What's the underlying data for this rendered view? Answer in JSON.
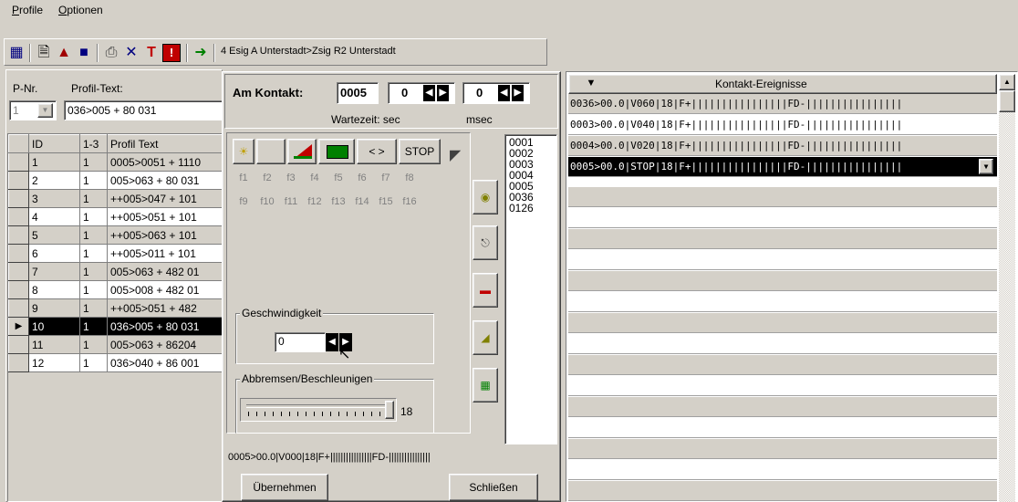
{
  "menu": {
    "items": [
      "Profile",
      "Optionen"
    ]
  },
  "toolbar": {
    "route_text": "4 Esig A Unterstadt>Zsig R2 Unterstadt"
  },
  "left": {
    "pnr_label": "P-Nr.",
    "profil_text_label": "Profil-Text:",
    "pnr_value": "1",
    "profil_text_value": "036>005 + 80 031",
    "table": {
      "headers": [
        "ID",
        "1-3",
        "Profil Text"
      ],
      "rows": [
        {
          "id": "1",
          "k": "1",
          "text": "0005>0051 + 1110"
        },
        {
          "id": "2",
          "k": "1",
          "text": "005>063 + 80 031"
        },
        {
          "id": "3",
          "k": "1",
          "text": "++005>047 + 101"
        },
        {
          "id": "4",
          "k": "1",
          "text": "++005>051 + 101"
        },
        {
          "id": "5",
          "k": "1",
          "text": "++005>063 + 101"
        },
        {
          "id": "6",
          "k": "1",
          "text": "++005>011 + 101"
        },
        {
          "id": "7",
          "k": "1",
          "text": "005>063 + 482 01"
        },
        {
          "id": "8",
          "k": "1",
          "text": "005>008 + 482 01"
        },
        {
          "id": "9",
          "k": "1",
          "text": "++005>051 + 482"
        },
        {
          "id": "10",
          "k": "1",
          "text": "036>005 + 80 031"
        },
        {
          "id": "11",
          "k": "1",
          "text": "005>063 + 86204"
        },
        {
          "id": "12",
          "k": "1",
          "text": "036>040 + 86 001"
        }
      ]
    }
  },
  "dialog": {
    "am_kontakt_label": "Am Kontakt:",
    "kontakt_value": "0005",
    "sec_value": "0",
    "msec_value": "0",
    "wartezeit_label": "Wartezeit:  sec",
    "msec_label": "msec",
    "arrows_label": "< >",
    "stop_label": "STOP",
    "f_row1": [
      "f1",
      "f2",
      "f3",
      "f4",
      "f5",
      "f6",
      "f7",
      "f8"
    ],
    "f_row2": [
      "f9",
      "f10",
      "f11",
      "f12",
      "f13",
      "f14",
      "f15",
      "f16"
    ],
    "contacts": [
      "0001",
      "0002",
      "0003",
      "0004",
      "0005",
      "0036",
      "0126"
    ],
    "geschwindigkeit_label": "Geschwindigkeit",
    "geschwindigkeit_value": "0",
    "abbremsen_label": "Abbremsen/Beschleunigen",
    "abbremsen_value": "18",
    "status_line": "0005>00.0|V000|18|F+||||||||||||||||FD-||||||||||||||||",
    "uebernehmen_label": "Übernehmen",
    "schliessen_label": "Schließen"
  },
  "events": {
    "title": "Kontakt-Ereignisse",
    "rows": [
      "0036>00.0|V060|18|F+||||||||||||||||FD-||||||||||||||||",
      "0003>00.0|V040|18|F+||||||||||||||||FD-||||||||||||||||",
      "0004>00.0|V020|18|F+||||||||||||||||FD-||||||||||||||||",
      "0005>00.0|STOP|18|F+||||||||||||||||FD-||||||||||||||||"
    ]
  }
}
